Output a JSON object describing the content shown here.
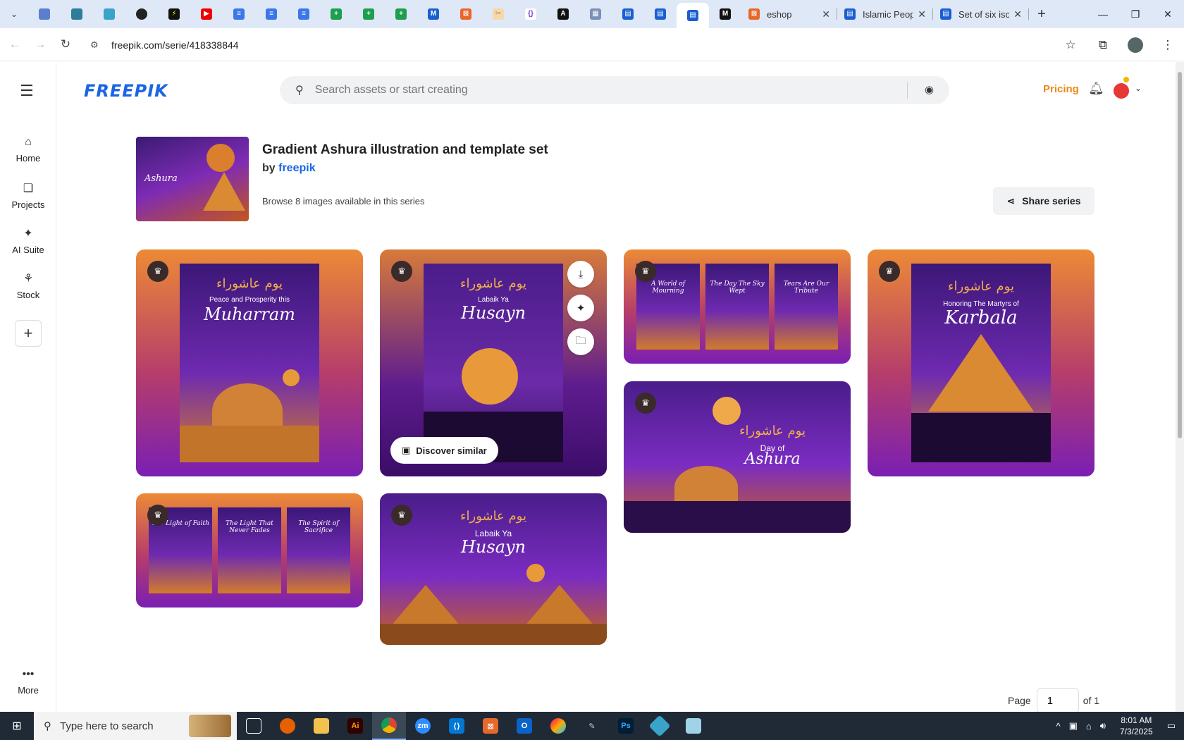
{
  "browser": {
    "tabs": [
      {
        "title": "eshop"
      },
      {
        "title": "Islamic Peop"
      },
      {
        "title": "Set of six iso"
      }
    ],
    "url": "freepik.com/serie/418338844"
  },
  "site": {
    "logo": "FREEPIK",
    "search_placeholder": "Search assets or start creating",
    "pricing": "Pricing"
  },
  "sidebar": {
    "items": [
      {
        "label": "Home",
        "icon": "home-icon"
      },
      {
        "label": "Projects",
        "icon": "projects-icon"
      },
      {
        "label": "AI Suite",
        "icon": "sparkle-icon"
      },
      {
        "label": "Stock",
        "icon": "stock-icon"
      }
    ],
    "more": "More"
  },
  "series": {
    "title": "Gradient Ashura illustration and template set",
    "by_prefix": "by",
    "author": "freepik",
    "count_text": "Browse 8 images available in this series",
    "share_label": "Share series",
    "thumb_text": "Ashura"
  },
  "cards": [
    {
      "arabic": "يوم عاشوراء",
      "subtitle": "Peace and Prosperity this",
      "title": "Muharram"
    },
    {
      "arabic": "يوم عاشوراء",
      "subtitle": "Labaik Ya",
      "title": "Husayn",
      "discover": "Discover similar"
    },
    {
      "panels": [
        "A World of Mourning",
        "The Day The Sky Wept",
        "Tears Are Our Tribute"
      ]
    },
    {
      "arabic": "يوم عاشوراء",
      "subtitle": "Day of",
      "title": "Ashura"
    },
    {
      "arabic": "يوم عاشوراء",
      "subtitle": "Honoring The Martyrs of",
      "title": "Karbala"
    },
    {
      "panels": [
        "The Light of Faith",
        "The Light That Never Fades",
        "The Spirit of Sacrifice"
      ]
    },
    {
      "arabic": "يوم عاشوراء",
      "subtitle": "Labaik Ya",
      "title": "Husayn"
    }
  ],
  "pager": {
    "label": "Page",
    "value": "1",
    "of": "of 1"
  },
  "taskbar": {
    "search_placeholder": "Type here to search",
    "time": "8:01 AM",
    "date": "7/3/2025"
  }
}
